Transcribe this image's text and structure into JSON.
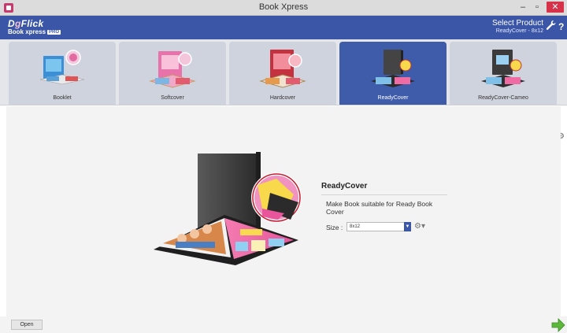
{
  "window": {
    "title": "Book Xpress",
    "controls": {
      "minimize": "–",
      "maximize": "▫",
      "close": "✕"
    }
  },
  "header": {
    "brand_prefix": "D",
    "brand_accent": "g",
    "brand_suffix": "Flick",
    "brand_sub": "Book xpress",
    "brand_badge": "PRO",
    "select_product_label": "Select Product",
    "select_product_value": "ReadyCover - 8x12",
    "icons": {
      "settings": "wrench-icon",
      "help": "help-icon"
    }
  },
  "tabs": [
    {
      "label": "Booklet",
      "active": false
    },
    {
      "label": "Softcover",
      "active": false
    },
    {
      "label": "Hardcover",
      "active": false
    },
    {
      "label": "ReadyCover",
      "active": true
    },
    {
      "label": "ReadyCover-Cameo",
      "active": false
    }
  ],
  "product": {
    "title": "ReadyCover",
    "description": "Make Book suitable for Ready Book Cover",
    "size_label": "Size :",
    "size_value": "8x12"
  },
  "footer": {
    "open_label": "Open"
  },
  "colors": {
    "brand_blue": "#3b56a6",
    "tab_inactive": "#cfd3de",
    "close_red": "#d6324a",
    "next_green": "#5cb83a"
  }
}
